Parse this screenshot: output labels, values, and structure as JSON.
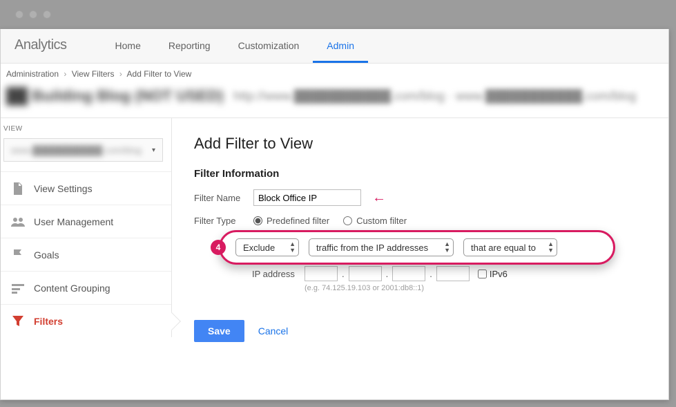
{
  "logo": "Analytics",
  "topnav": {
    "home": "Home",
    "reporting": "Reporting",
    "customization": "Customization",
    "admin": "Admin"
  },
  "breadcrumb": {
    "a": "Administration",
    "b": "View Filters",
    "c": "Add Filter to View"
  },
  "sidebar": {
    "header": "VIEW",
    "items": [
      {
        "label": "View Settings"
      },
      {
        "label": "User Management"
      },
      {
        "label": "Goals"
      },
      {
        "label": "Content Grouping"
      },
      {
        "label": "Filters"
      }
    ]
  },
  "page": {
    "title": "Add Filter to View",
    "section": "Filter Information",
    "filter_name_label": "Filter Name",
    "filter_name_value": "Block Office IP",
    "filter_type_label": "Filter Type",
    "radio_predefined": "Predefined filter",
    "radio_custom": "Custom filter",
    "sel1": "Exclude",
    "sel2": "traffic from the IP addresses",
    "sel3": "that are equal to",
    "ip_label": "IP address",
    "ipv6_label": "IPv6",
    "ip_example": "(e.g. 74.125.19.103 or 2001:db8::1)",
    "save": "Save",
    "cancel": "Cancel",
    "badge": "4"
  }
}
